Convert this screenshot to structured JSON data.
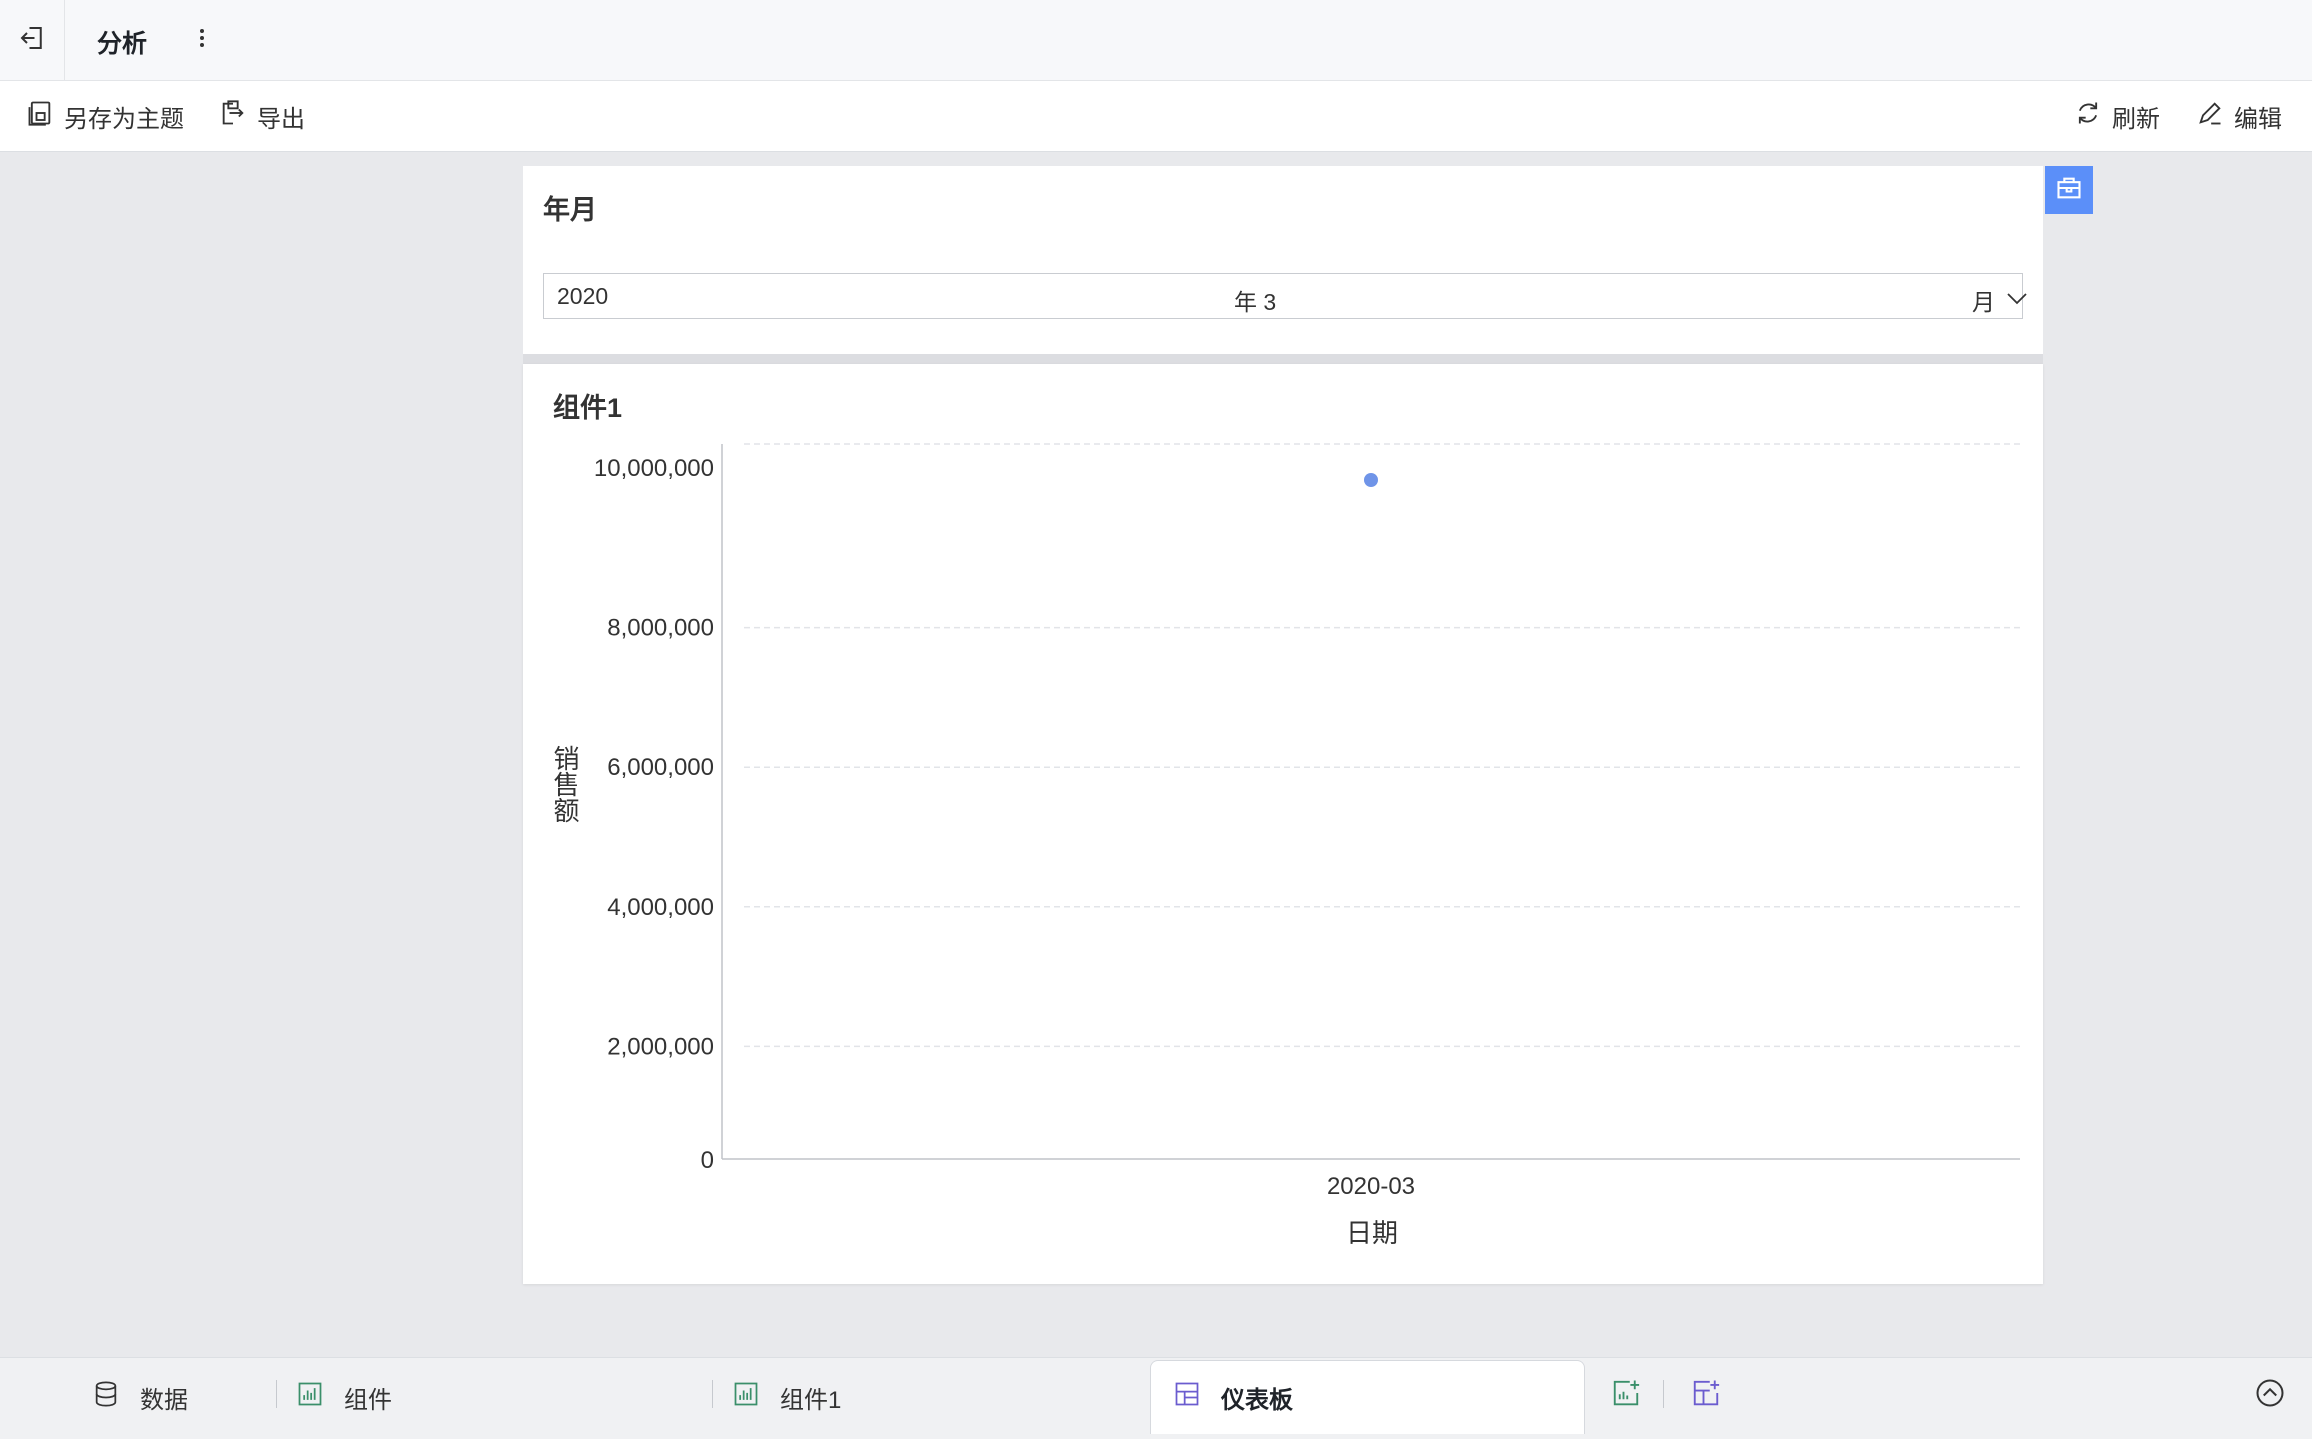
{
  "header": {
    "title": "分析"
  },
  "toolbar": {
    "save_theme": "另存为主题",
    "export": "导出",
    "refresh": "刷新",
    "edit": "编辑"
  },
  "filter": {
    "title": "年月",
    "year": "2020",
    "mid": "年 3",
    "month": "月"
  },
  "chart": {
    "title": "组件1",
    "accent_color": "#6f94e8"
  },
  "chart_data": {
    "type": "scatter",
    "x": [
      "2020-03"
    ],
    "series": [
      {
        "values": [
          9500000
        ]
      }
    ],
    "xlabel": "日期",
    "ylabel": "销售额",
    "ylim": [
      0,
      10000000
    ],
    "yticks": [
      "10,000,000",
      "8,000,000",
      "6,000,000",
      "4,000,000",
      "2,000,000",
      "0"
    ],
    "grid": true
  },
  "bottom_tabs": {
    "data": "数据",
    "comp": "组件",
    "comp1": "组件1",
    "dashboard": "仪表板"
  }
}
